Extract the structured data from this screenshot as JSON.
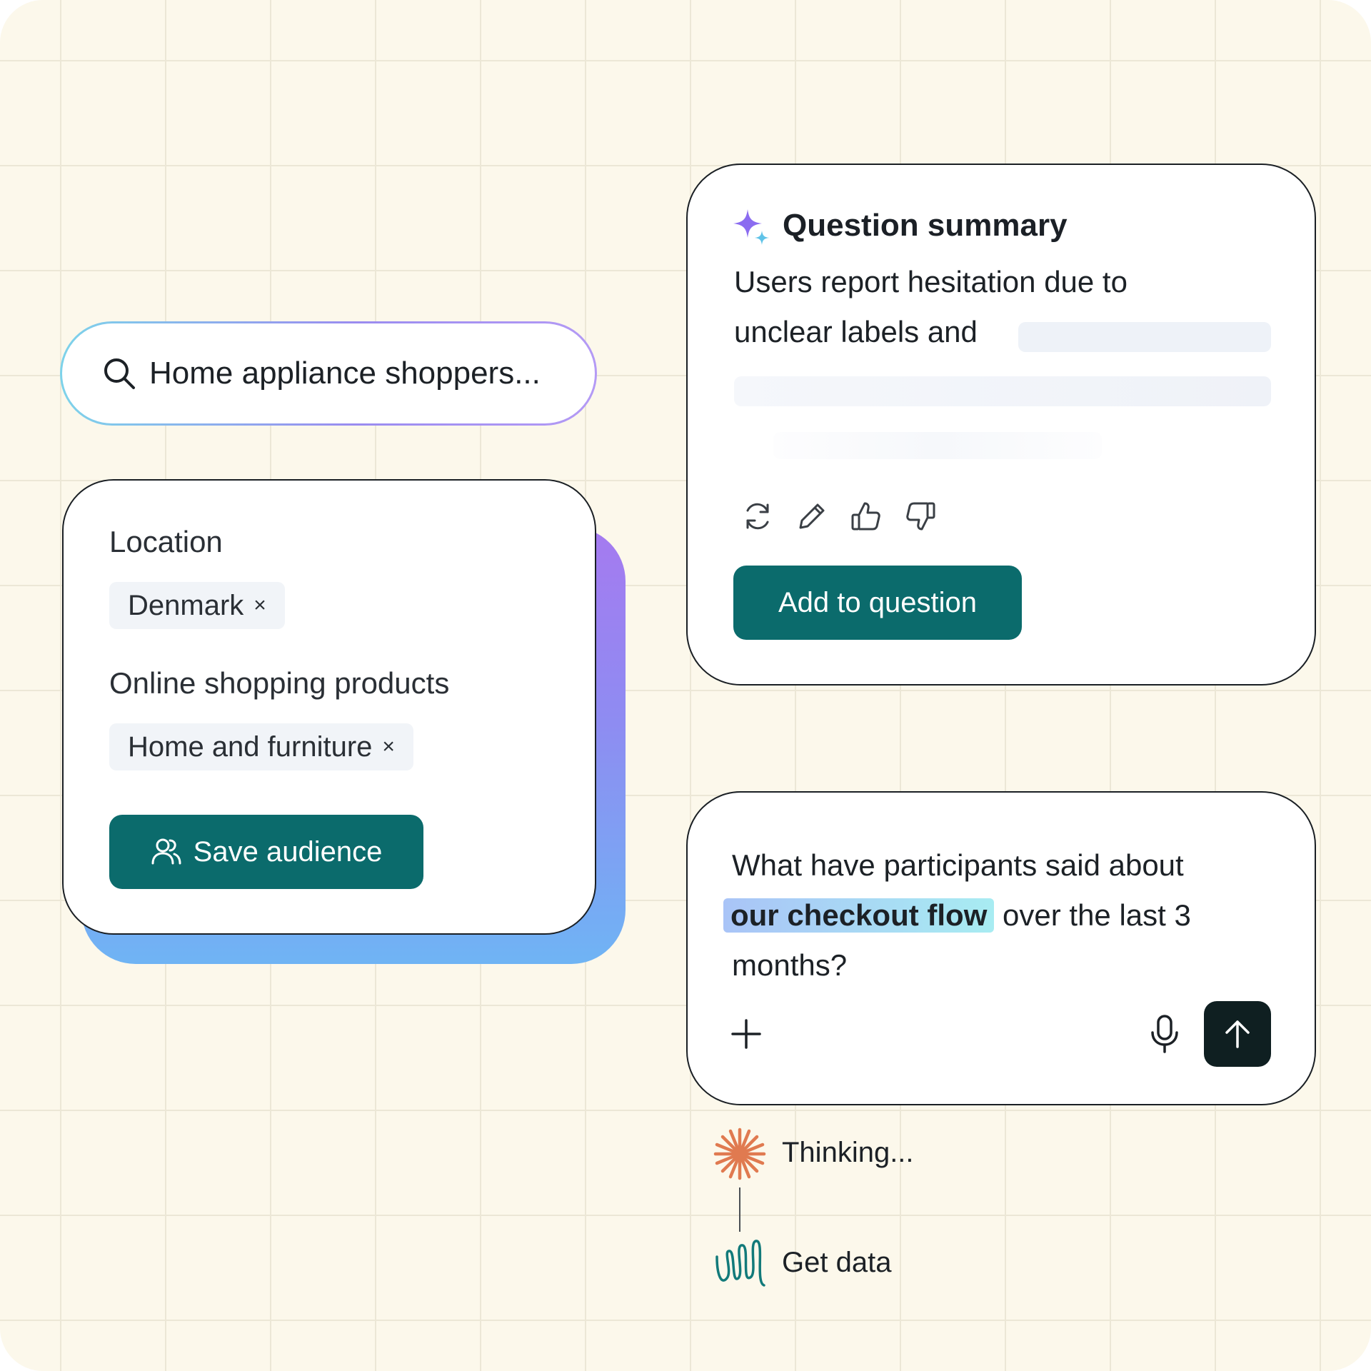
{
  "search": {
    "text": "Home appliance shoppers..."
  },
  "audience": {
    "location_label": "Location",
    "location_chip": "Denmark",
    "products_label": "Online shopping products",
    "products_chip": "Home and furniture",
    "chip_remove_glyph": "×",
    "save_label": "Save audience"
  },
  "summary": {
    "title": "Question summary",
    "line1": "Users report hesitation due to",
    "line2": "unclear labels and",
    "add_label": "Add to question"
  },
  "question": {
    "line1": "What have participants said about",
    "highlight": "our checkout flow",
    "line2_rest": " over the last 3",
    "line3": "months?"
  },
  "steps": {
    "thinking": "Thinking...",
    "get_data": "Get data"
  },
  "icons": {
    "search": "search-icon",
    "users": "users-icon",
    "sparkle": "sparkle-icon",
    "refresh": "refresh-icon",
    "edit": "pencil-icon",
    "thumbs_up": "thumbs-up-icon",
    "thumbs_down": "thumbs-down-icon",
    "plus": "plus-icon",
    "microphone": "microphone-icon",
    "send": "arrow-up-icon",
    "thinking": "asterisk-icon",
    "get_data": "squiggle-icon"
  },
  "colors": {
    "background": "#fcf8eb",
    "accent": "#0b6b6c",
    "send_button": "#0f1f21",
    "thinking_icon": "#e07a50",
    "get_data_icon": "#127a7a",
    "gradient_start": "#a57af0",
    "gradient_end": "#6fb4f4"
  }
}
